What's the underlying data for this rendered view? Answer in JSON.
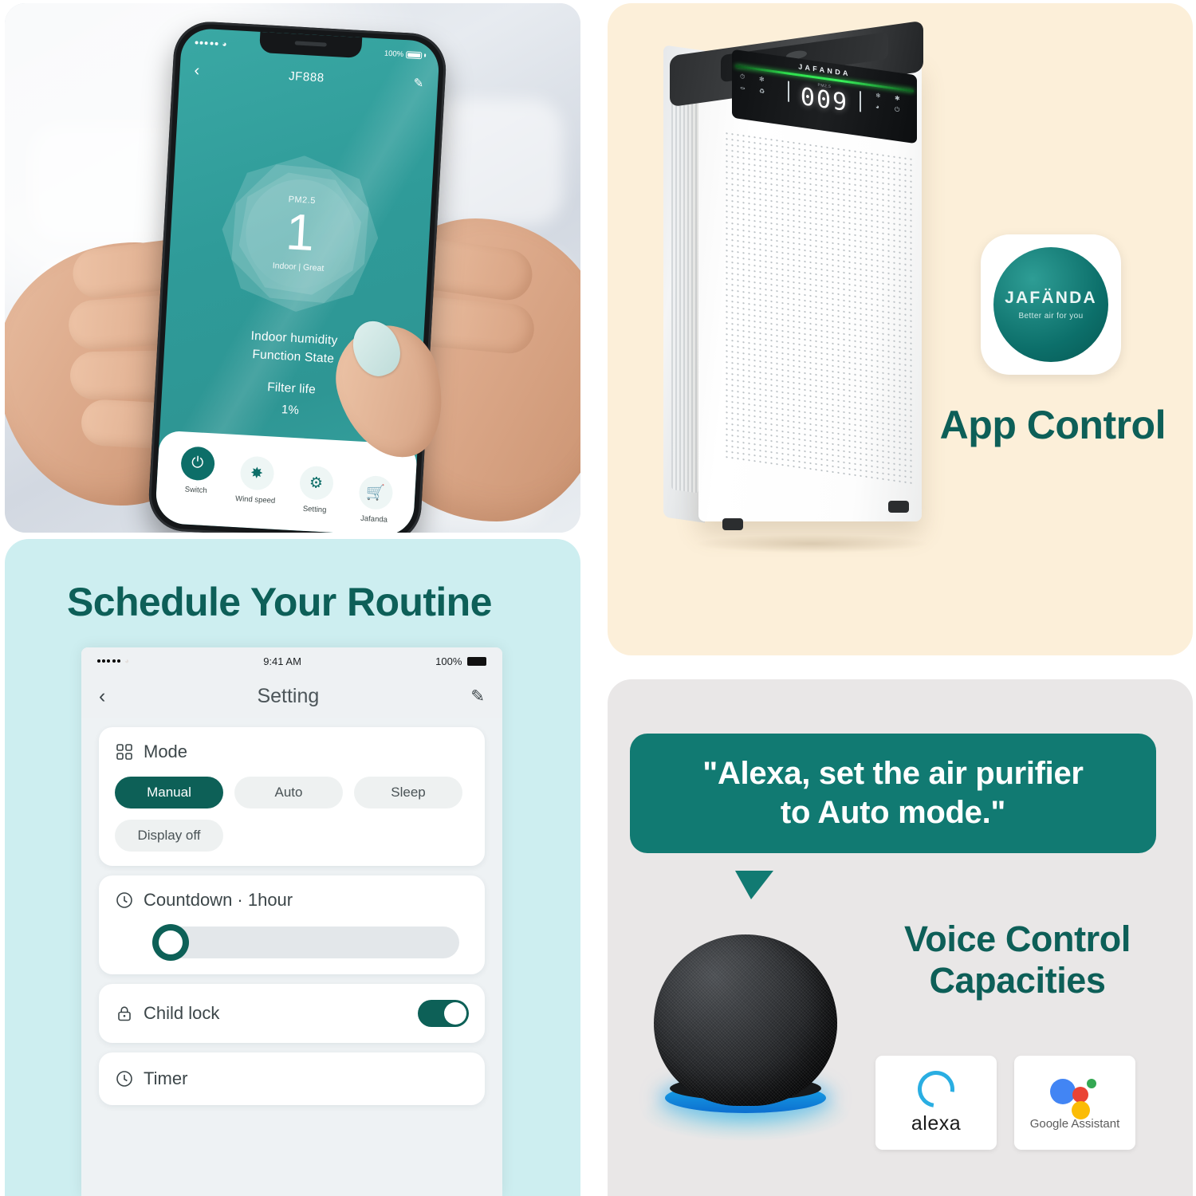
{
  "panels": {
    "app_photo": {
      "name": "app-control-photo"
    },
    "purifier": {
      "name": "purifier-showcase"
    },
    "schedule": {
      "name": "schedule-routine"
    },
    "voice": {
      "name": "voice-control"
    }
  },
  "phone_app": {
    "status": {
      "battery": "100%"
    },
    "nav": {
      "back_icon": "chevron-left-icon",
      "title": "JF888",
      "edit_icon": "pencil-icon"
    },
    "aqi": {
      "label": "PM2.5",
      "value": "1",
      "sub": "Indoor | Great"
    },
    "stats": [
      "Indoor humidity",
      "Function State",
      "Filter life"
    ],
    "filter_percent": "1%",
    "tabs": [
      {
        "label": "Switch",
        "icon": "power-icon",
        "glyph": "⏻",
        "active": true
      },
      {
        "label": "Wind speed",
        "icon": "fan-icon",
        "glyph": "⚘",
        "active": false
      },
      {
        "label": "Setting",
        "icon": "gear-icon",
        "glyph": "⚙",
        "active": false
      },
      {
        "label": "Jafanda",
        "icon": "cart-icon",
        "glyph": "🛒",
        "active": false
      }
    ]
  },
  "purifier": {
    "brand_on_unit": "JAFANDA",
    "display": {
      "pm_label": "PM2.5",
      "reading": "009"
    },
    "panel_icons_left": [
      "⏱",
      "✿",
      "⚡",
      "♻"
    ],
    "panel_icons_right": [
      "❄",
      "✱",
      "ᴘ",
      "⏻"
    ],
    "badge": {
      "word": "JAFÄNDA",
      "tagline": "Better air for you"
    },
    "headline": "App Control"
  },
  "schedule": {
    "headline": "Schedule Your Routine",
    "status_bar": {
      "time": "9:41 AM",
      "battery": "100%"
    },
    "nav": {
      "back_icon": "chevron-left-icon",
      "title": "Setting",
      "edit_icon": "pencil-icon"
    },
    "mode_card": {
      "icon": "grid-icon",
      "label": "Mode",
      "options": [
        {
          "label": "Manual",
          "selected": true
        },
        {
          "label": "Auto",
          "selected": false
        },
        {
          "label": "Sleep",
          "selected": false
        },
        {
          "label": "Display off",
          "selected": false
        }
      ]
    },
    "countdown_card": {
      "icon": "clock-icon",
      "label": "Countdown · 1hour",
      "slider_value": 0
    },
    "child_lock_row": {
      "icon": "lock-icon",
      "label": "Child lock",
      "enabled": true
    },
    "timer_row": {
      "icon": "clock-icon",
      "label": "Timer"
    }
  },
  "voice": {
    "bubble_line1": "\"Alexa, set the air purifier",
    "bubble_line2": "to Auto mode.\"",
    "title_line1": "Voice Control",
    "title_line2": "Capacities",
    "assistants": [
      {
        "name": "alexa",
        "icon": "alexa-logo"
      },
      {
        "name": "Google Assistant",
        "icon": "google-assistant-logo"
      }
    ]
  },
  "colors": {
    "teal_dark": "#0d5f58",
    "teal_bubble": "#117a72",
    "cream": "#fcefd9",
    "cyan": "#cdeef0",
    "gray": "#e9e7e7"
  }
}
